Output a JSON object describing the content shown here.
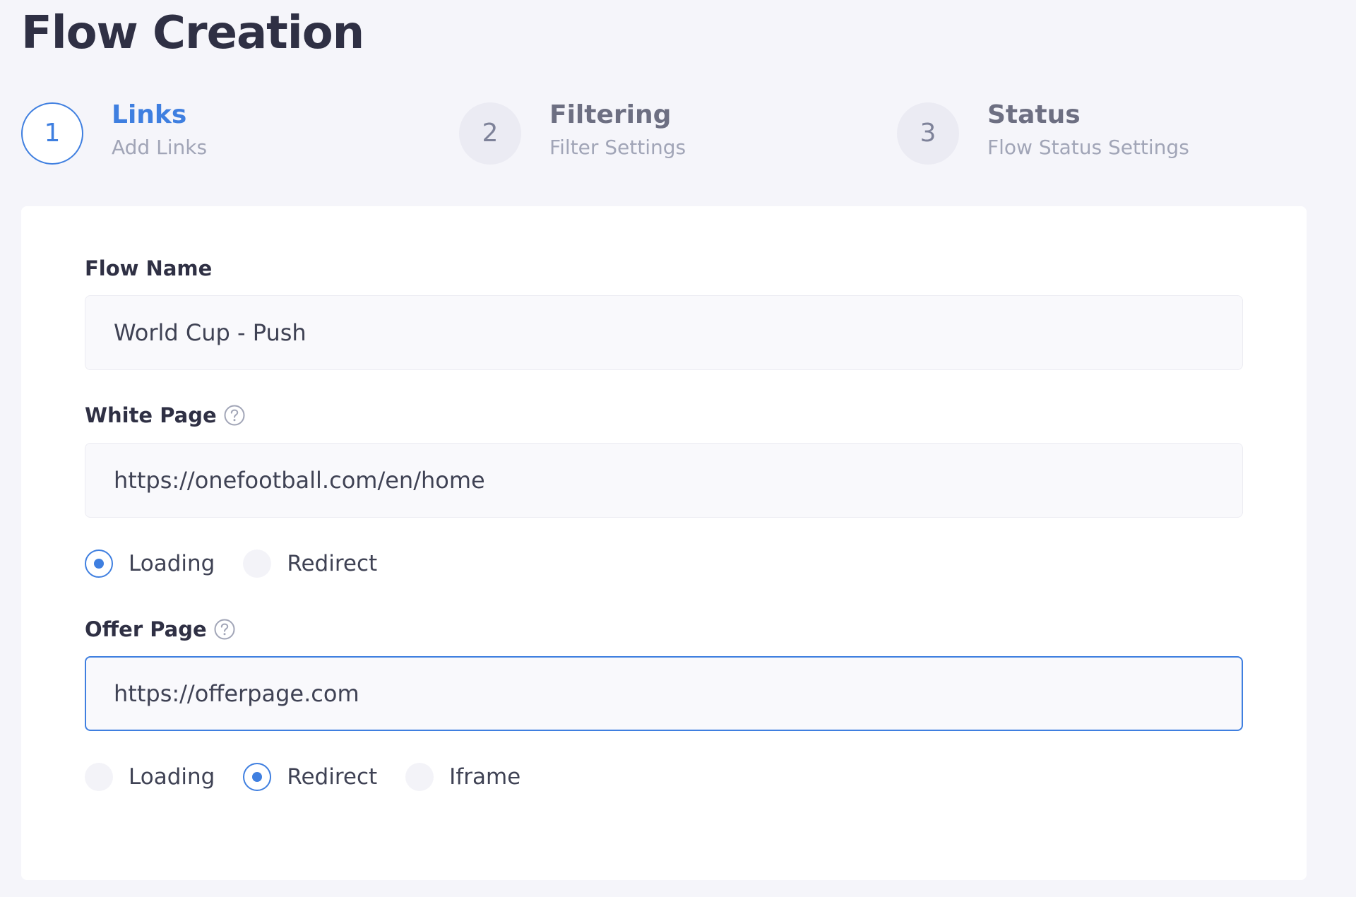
{
  "page": {
    "title": "Flow Creation"
  },
  "stepper": {
    "steps": [
      {
        "number": "1",
        "title": "Links",
        "subtitle": "Add Links",
        "state": "active"
      },
      {
        "number": "2",
        "title": "Filtering",
        "subtitle": "Filter Settings",
        "state": "pending"
      },
      {
        "number": "3",
        "title": "Status",
        "subtitle": "Flow Status Settings",
        "state": "pending"
      }
    ]
  },
  "form": {
    "flow_name": {
      "label": "Flow Name",
      "value": "World Cup - Push"
    },
    "white_page": {
      "label": "White Page",
      "help_icon": "question-circle-icon",
      "value": "https://onefootball.com/en/home",
      "mode_options": [
        "Loading",
        "Redirect"
      ],
      "mode_selected": "Loading"
    },
    "offer_page": {
      "label": "Offer Page",
      "help_icon": "question-circle-icon",
      "value": "https://offerpage.com",
      "focused": true,
      "mode_options": [
        "Loading",
        "Redirect",
        "Iframe"
      ],
      "mode_selected": "Redirect"
    }
  },
  "colors": {
    "accent": "#3f7fe0",
    "page_background": "#f5f5fa",
    "card_background": "#ffffff",
    "title_text": "#2f3044"
  }
}
